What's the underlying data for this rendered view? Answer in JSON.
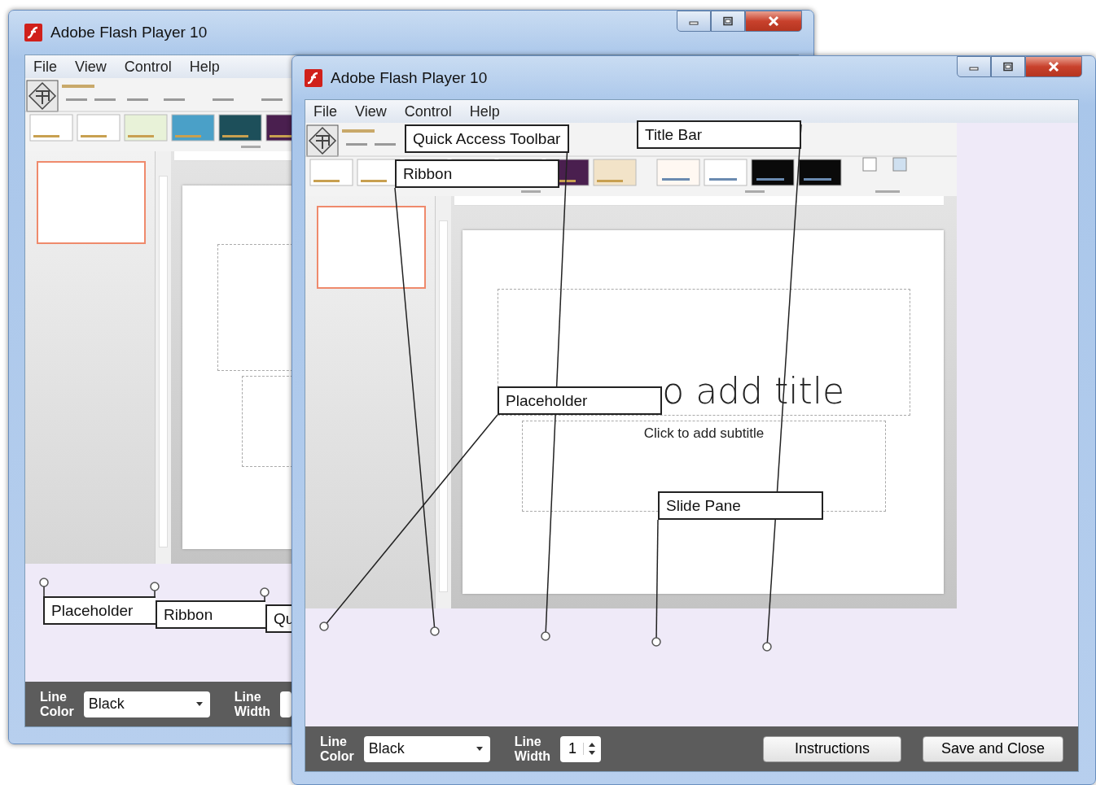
{
  "windows": [
    {
      "title": "Adobe Flash Player 10",
      "menu": [
        "File",
        "View",
        "Control",
        "Help"
      ],
      "callouts": [
        {
          "label": "Placeholder"
        },
        {
          "label": "Ribbon"
        },
        {
          "label": "Qu"
        }
      ],
      "line_color": {
        "label": "Line Color",
        "value": "Black"
      },
      "line_width": {
        "label": "Line Width"
      }
    },
    {
      "title": "Adobe Flash Player 10",
      "menu": [
        "File",
        "View",
        "Control",
        "Help"
      ],
      "slide": {
        "title": "o add title",
        "subtitle": "Click to add subtitle"
      },
      "callouts": [
        {
          "label": "Quick Access Toolbar"
        },
        {
          "label": "Title Bar"
        },
        {
          "label": "Ribbon"
        },
        {
          "label": "Placeholder"
        },
        {
          "label": "Slide Pane"
        }
      ],
      "line_color": {
        "label": "Line Color",
        "value": "Black"
      },
      "line_width": {
        "label": "Line Width",
        "value": "1"
      },
      "buttons": [
        "Instructions",
        "Save and Close"
      ]
    }
  ]
}
